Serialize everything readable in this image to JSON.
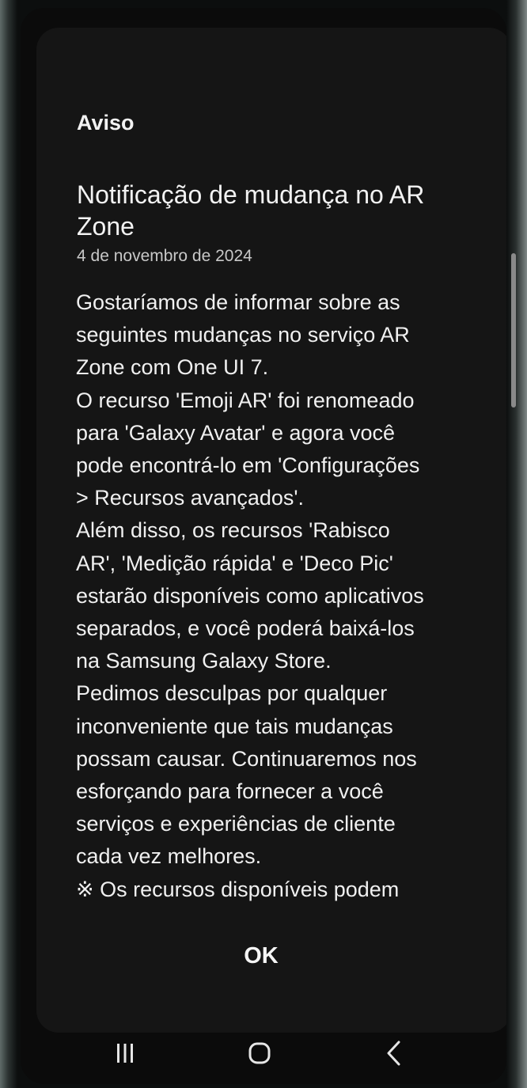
{
  "dialog": {
    "header": "Aviso",
    "title": "Notificação de mudança no AR Zone",
    "date": "4 de novembro de 2024",
    "body": "Gostaríamos de informar sobre as\nseguintes mudanças no serviço AR\nZone com One UI 7.\nO recurso 'Emoji AR' foi renomeado\npara 'Galaxy Avatar' e agora você\npode encontrá-lo em 'Configurações\n> Recursos avançados'.\nAlém disso, os recursos 'Rabisco\nAR', 'Medição rápida' e 'Deco Pic'\nestarão disponíveis como aplicativos\nseparados, e você poderá baixá-los\nna Samsung Galaxy Store.\nPedimos desculpas por qualquer\ninconveniente que tais mudanças\npossam causar. Continuaremos nos\nesforçando para fornecer a você\nserviços e experiências de cliente\ncada vez melhores.\n※ Os recursos disponíveis podem",
    "ok_label": "OK"
  },
  "navbar": {
    "items": [
      {
        "icon": "recents-icon"
      },
      {
        "icon": "home-icon"
      },
      {
        "icon": "back-icon"
      }
    ]
  }
}
